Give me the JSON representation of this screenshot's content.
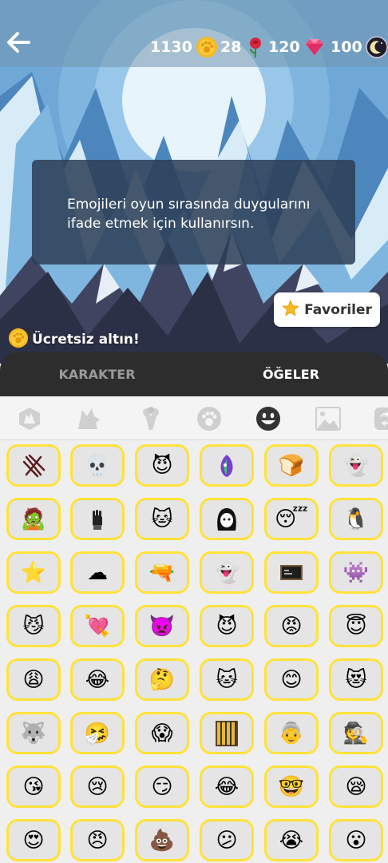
{
  "header": {
    "currencies": [
      {
        "name": "gold",
        "value": "1130",
        "icon": "paw-coin-icon",
        "color": "#f7b91f"
      },
      {
        "name": "roses",
        "value": "28",
        "icon": "rose-icon",
        "color": "#d7263d"
      },
      {
        "name": "gems",
        "value": "120",
        "icon": "gem-icon",
        "color": "#f14b7d"
      },
      {
        "name": "moon",
        "value": "100",
        "icon": "moon-token-icon",
        "color": "#1d1d2b"
      }
    ]
  },
  "info": {
    "text": "Emojileri oyun sırasında duygularını ifade etmek için kullanırsın."
  },
  "favorites": {
    "label": "Favoriler"
  },
  "free_gold": {
    "label": "Ücretsiz altın!"
  },
  "tabs": [
    {
      "label": "KARAKTER",
      "active": false
    },
    {
      "label": "ÖĞELER",
      "active": true
    }
  ],
  "categories": [
    {
      "name": "wolf-badge-icon",
      "active": false
    },
    {
      "name": "wolf-head-icon",
      "active": false
    },
    {
      "name": "rose-bouquet-icon",
      "active": false
    },
    {
      "name": "paw-icon",
      "active": false
    },
    {
      "name": "smiley-icon",
      "active": true
    },
    {
      "name": "landscape-icon",
      "active": false
    },
    {
      "name": "exchange-icon",
      "active": false
    }
  ],
  "emojis": [
    [
      "scratch-marks",
      "skull-character",
      "purple-flame-face",
      "purple-dragon",
      "bread-character",
      "cyan-ghost"
    ],
    [
      "zombie-character",
      "black-glove",
      "cat-pig-character",
      "hooded-figure",
      "sleepy-pig",
      "penguin"
    ],
    [
      "star-badge",
      "white-cloud",
      "gun-character",
      "white-ghost",
      "chalkboard",
      "purple-monster"
    ],
    [
      "purple-cat",
      "winged-heart",
      "devil-bat",
      "devil-face",
      "angry-fire-face",
      "angel-face"
    ],
    [
      "tired-face",
      "crying-laugh",
      "thinking-face",
      "cat-face",
      "blushing-face",
      "meow-face"
    ],
    [
      "werewolf",
      "sneezing-face",
      "scared-face",
      "jail-bars",
      "grandma-face",
      "detective-face"
    ],
    [
      "kiss-face",
      "crying-face",
      "smirk-face",
      "laughing-tears",
      "glasses-face",
      "sleepy-face"
    ],
    [
      "heart-eyes",
      "angry-face",
      "poop",
      "confused-face",
      "sobbing-face",
      "surprised-face"
    ]
  ],
  "emoji_glyphs": [
    [
      "",
      "💀",
      "😈",
      "",
      "🍞",
      "👻"
    ],
    [
      "🧟",
      "",
      "🐱",
      "",
      "😴",
      "🐧"
    ],
    [
      "⭐",
      "☁",
      "🔫",
      "👻",
      "",
      "👾"
    ],
    [
      "😼",
      "💘",
      "👿",
      "😈",
      "😡",
      "😇"
    ],
    [
      "😩",
      "😂",
      "🤔",
      "🐱",
      "😊",
      "😻"
    ],
    [
      "🐺",
      "🤧",
      "😱",
      "",
      "👵",
      "🕵"
    ],
    [
      "😘",
      "😢",
      "😏",
      "😂",
      "🤓",
      "😪"
    ],
    [
      "😍",
      "😠",
      "💩",
      "😕",
      "😭",
      "😮"
    ]
  ]
}
